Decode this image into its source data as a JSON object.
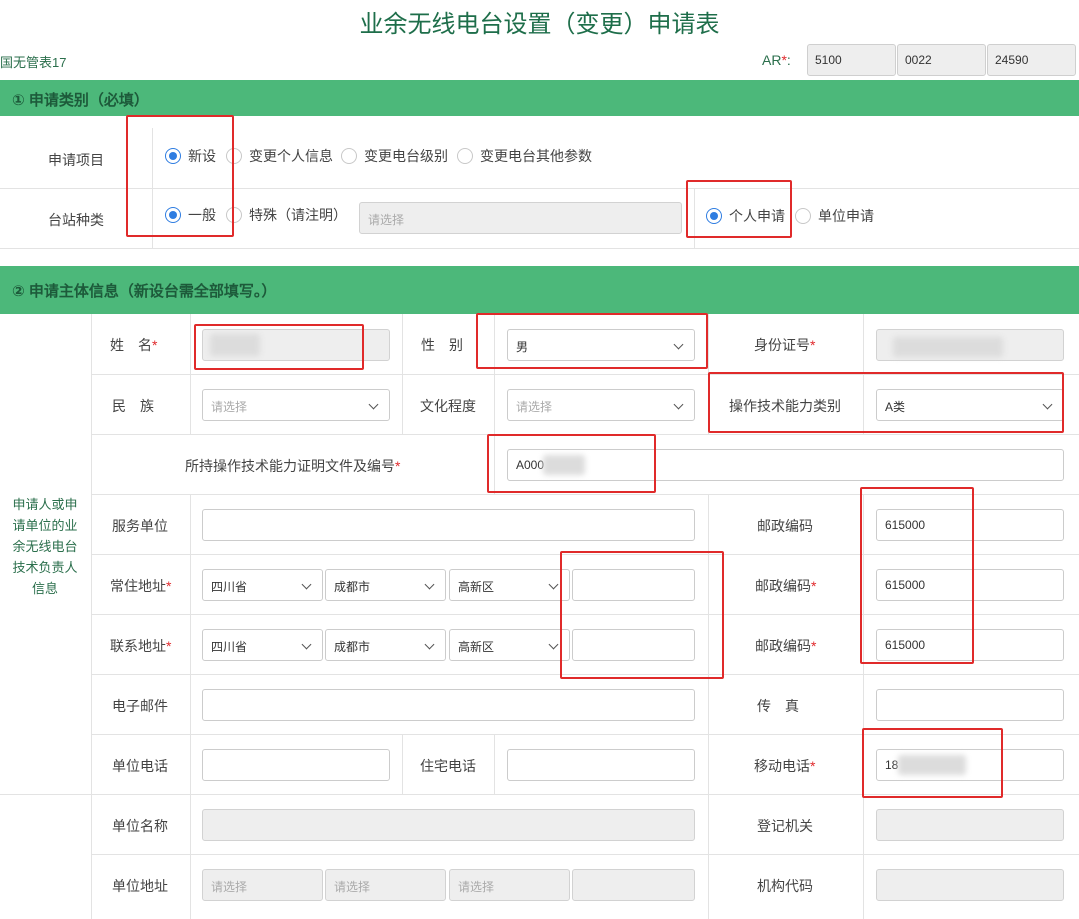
{
  "page": {
    "title": "业余无线电台设置（变更）申请表",
    "form_no": "国无管表17"
  },
  "ar": {
    "label": "AR",
    "required_mark": "*",
    "colon": ":",
    "values": [
      "5100",
      "0022",
      "24590"
    ]
  },
  "section1": {
    "title": "① 申请类别（必填）",
    "apply_item": {
      "label": "申请项目",
      "options": [
        "新设",
        "变更个人信息",
        "变更电台级别",
        "变更电台其他参数"
      ],
      "selected": "新设"
    },
    "station_type": {
      "label": "台站种类",
      "options": [
        "一般",
        "特殊（请注明）"
      ],
      "selected": "一般",
      "special_placeholder": "请选择"
    },
    "applicant_type": {
      "options": [
        "个人申请",
        "单位申请"
      ],
      "selected": "个人申请"
    }
  },
  "section2": {
    "title": "② 申请主体信息（新设台需全部填写。）",
    "side_label": "申请人或申请单位的业余无线电台技术负责人信息",
    "name": {
      "label": "姓　名",
      "value": ""
    },
    "gender": {
      "label": "性　别",
      "value": "男"
    },
    "id_number": {
      "label": "身份证号",
      "value": ""
    },
    "ethnicity": {
      "label": "民　族",
      "placeholder": "请选择"
    },
    "education": {
      "label": "文化程度",
      "placeholder": "请选择"
    },
    "op_class": {
      "label": "操作技术能力类别",
      "value": "A类"
    },
    "cert": {
      "label": "所持操作技术能力证明文件及编号",
      "value": "A000"
    },
    "employer": {
      "label": "服务单位",
      "value": ""
    },
    "employer_postcode": {
      "label": "邮政编码",
      "value": "615000"
    },
    "residence": {
      "label": "常住地址",
      "province": "四川省",
      "city": "成都市",
      "district": "高新区",
      "detail": "",
      "postcode_label": "邮政编码",
      "postcode": "615000"
    },
    "contact": {
      "label": "联系地址",
      "province": "四川省",
      "city": "成都市",
      "district": "高新区",
      "detail": "",
      "postcode_label": "邮政编码",
      "postcode": "615000"
    },
    "email": {
      "label": "电子邮件",
      "value": ""
    },
    "fax": {
      "label": "传　真",
      "value": ""
    },
    "work_phone": {
      "label": "单位电话",
      "value": ""
    },
    "home_phone": {
      "label": "住宅电话",
      "value": ""
    },
    "mobile": {
      "label": "移动电话",
      "value": "18"
    },
    "org_name": {
      "label": "单位名称",
      "value": ""
    },
    "reg_authority": {
      "label": "登记机关",
      "value": ""
    },
    "org_address": {
      "label": "单位地址",
      "placeholder": "请选择"
    },
    "org_code": {
      "label": "机构代码",
      "value": ""
    }
  },
  "colors": {
    "section_bg": "#4cb87a",
    "title_text": "#1e6e4a",
    "radio_selected": "#2f7de1",
    "required": "#e0292c",
    "annotation_box": "#e02a2a"
  }
}
